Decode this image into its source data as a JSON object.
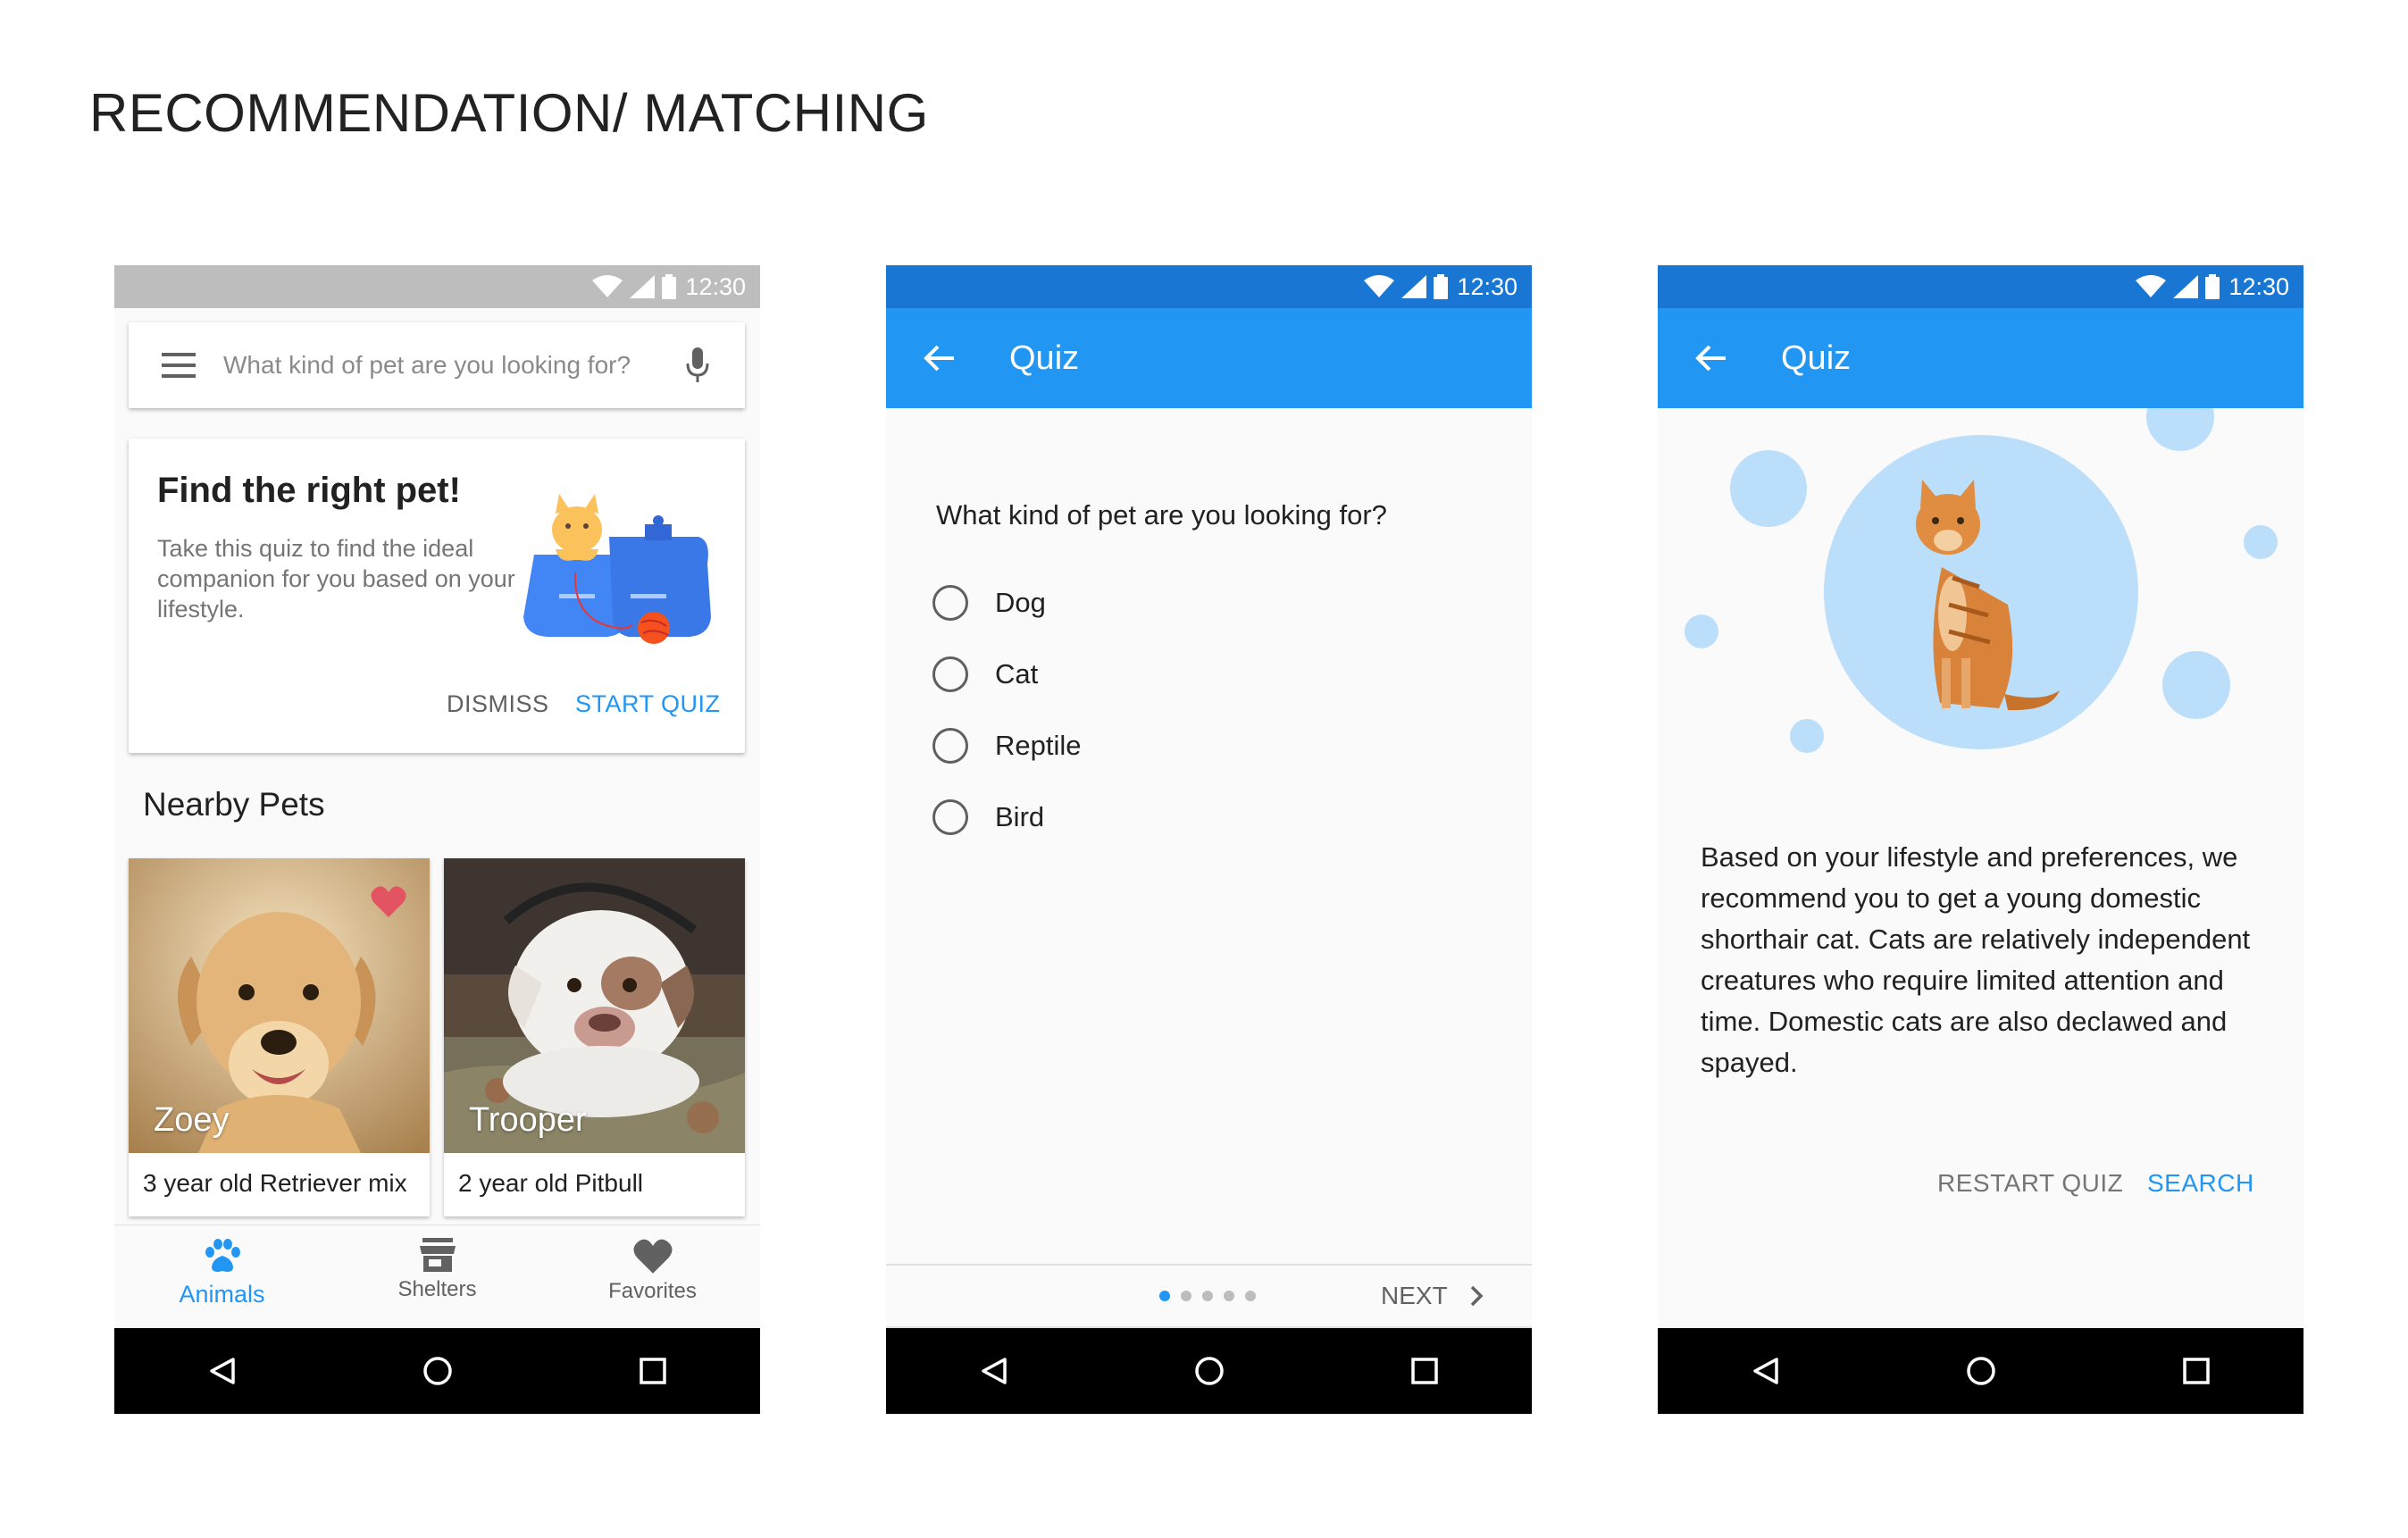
{
  "page_title": "RECOMMENDATION/ MATCHING",
  "status_time": "12:30",
  "colors": {
    "primary": "#2196f3",
    "status_blue": "#1976d2",
    "status_gray": "#bdbdbd",
    "heart": "#e35463"
  },
  "screen1": {
    "search_placeholder": "What kind of pet are you looking for?",
    "card": {
      "title": "Find the right pet!",
      "description": "Take this quiz to find the ideal companion for you based on your lifestyle.",
      "dismiss_label": "DISMISS",
      "start_label": "START QUIZ"
    },
    "nearby_title": "Nearby Pets",
    "pets": [
      {
        "name": "Zoey",
        "description": "3 year old Retriever mix",
        "favorited": true
      },
      {
        "name": "Trooper",
        "description": "2 year old Pitbull",
        "favorited": false
      }
    ],
    "bottom_nav": [
      {
        "label": "Animals",
        "icon": "paw-icon",
        "active": true
      },
      {
        "label": "Shelters",
        "icon": "storefront-icon",
        "active": false
      },
      {
        "label": "Favorites",
        "icon": "heart-icon",
        "active": false
      }
    ]
  },
  "screen2": {
    "appbar_title": "Quiz",
    "question": "What kind of pet are you looking for?",
    "options": [
      "Dog",
      "Cat",
      "Reptile",
      "Bird"
    ],
    "pager": {
      "current": 1,
      "total": 5
    },
    "next_label": "NEXT"
  },
  "screen3": {
    "appbar_title": "Quiz",
    "result_text": "Based on your lifestyle and preferences, we recommend you to get a young domestic shorthair cat. Cats are relatively independent creatures who require limited attention and time. Domestic cats are also declawed and spayed.",
    "restart_label": "RESTART QUIZ",
    "search_label": "SEARCH"
  }
}
